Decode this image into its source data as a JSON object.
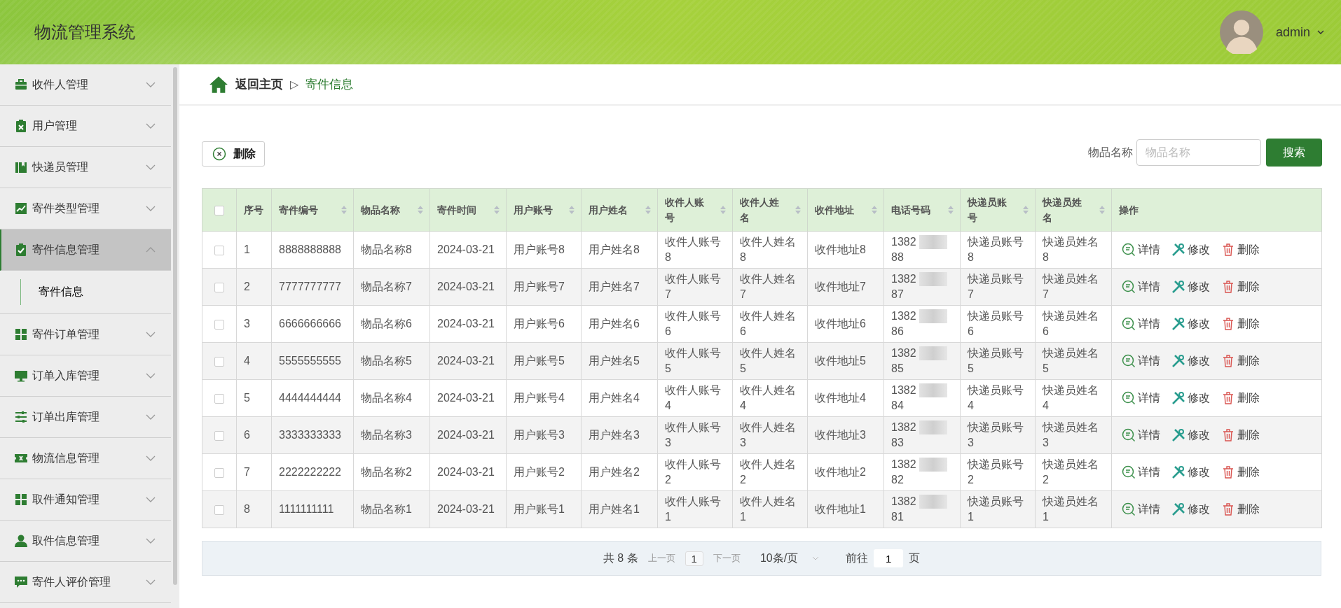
{
  "header": {
    "title": "物流管理系统",
    "user": "admin"
  },
  "sidebar": {
    "items": [
      {
        "label": "收件人管理",
        "expanded": false,
        "selected": false
      },
      {
        "label": "用户管理",
        "expanded": false,
        "selected": false
      },
      {
        "label": "快递员管理",
        "expanded": false,
        "selected": false
      },
      {
        "label": "寄件类型管理",
        "expanded": false,
        "selected": false
      },
      {
        "label": "寄件信息管理",
        "expanded": true,
        "selected": true,
        "children": [
          {
            "label": "寄件信息",
            "selected": false
          }
        ]
      },
      {
        "label": "寄件订单管理",
        "expanded": false,
        "selected": false
      },
      {
        "label": "订单入库管理",
        "expanded": false,
        "selected": false
      },
      {
        "label": "订单出库管理",
        "expanded": false,
        "selected": false
      },
      {
        "label": "物流信息管理",
        "expanded": false,
        "selected": false
      },
      {
        "label": "取件通知管理",
        "expanded": false,
        "selected": false
      },
      {
        "label": "取件信息管理",
        "expanded": false,
        "selected": false
      },
      {
        "label": "寄件人评价管理",
        "expanded": false,
        "selected": false
      }
    ]
  },
  "breadcrumb": {
    "home": "返回主页",
    "separator": "▷",
    "current": "寄件信息"
  },
  "toolbar": {
    "delete_button": "删除",
    "search_label": "物品名称",
    "search_placeholder": "物品名称",
    "search_button": "搜索"
  },
  "table": {
    "header_checked": false,
    "columns": [
      {
        "label": "序号",
        "sortable": false,
        "kind": "text"
      },
      {
        "label": "寄件编号",
        "sortable": true,
        "kind": "text"
      },
      {
        "label": "物品名称",
        "sortable": true,
        "kind": "text"
      },
      {
        "label": "寄件时间",
        "sortable": true,
        "kind": "text"
      },
      {
        "label": "用户账号",
        "sortable": true,
        "kind": "text"
      },
      {
        "label": "用户姓名",
        "sortable": true,
        "kind": "text"
      },
      {
        "label": "收件人账号",
        "sortable": true,
        "kind": "text"
      },
      {
        "label": "收件人姓名",
        "sortable": true,
        "kind": "text"
      },
      {
        "label": "收件地址",
        "sortable": true,
        "kind": "text"
      },
      {
        "label": "电话号码",
        "sortable": true,
        "kind": "masked"
      },
      {
        "label": "快递员账号",
        "sortable": true,
        "kind": "text"
      },
      {
        "label": "快递员姓名",
        "sortable": true,
        "kind": "text"
      },
      {
        "label": "操作",
        "sortable": false,
        "kind": "actions"
      }
    ],
    "rows": [
      {
        "checked": false,
        "cells": [
          "1",
          "8888888888",
          "物品名称8",
          "2024-03-21",
          "用户账号8",
          "用户姓名8",
          "收件人账号8",
          "收件人姓名8",
          "收件地址8",
          "1382",
          "快递员账号8",
          "快递员姓名8"
        ],
        "phone_tail": "88",
        "actions": [
          "详情",
          "修改",
          "删除"
        ]
      },
      {
        "checked": false,
        "cells": [
          "2",
          "7777777777",
          "物品名称7",
          "2024-03-21",
          "用户账号7",
          "用户姓名7",
          "收件人账号7",
          "收件人姓名7",
          "收件地址7",
          "1382",
          "快递员账号7",
          "快递员姓名7"
        ],
        "phone_tail": "87",
        "actions": [
          "详情",
          "修改",
          "删除"
        ]
      },
      {
        "checked": false,
        "cells": [
          "3",
          "6666666666",
          "物品名称6",
          "2024-03-21",
          "用户账号6",
          "用户姓名6",
          "收件人账号6",
          "收件人姓名6",
          "收件地址6",
          "1382",
          "快递员账号6",
          "快递员姓名6"
        ],
        "phone_tail": "86",
        "actions": [
          "详情",
          "修改",
          "删除"
        ]
      },
      {
        "checked": false,
        "cells": [
          "4",
          "5555555555",
          "物品名称5",
          "2024-03-21",
          "用户账号5",
          "用户姓名5",
          "收件人账号5",
          "收件人姓名5",
          "收件地址5",
          "1382",
          "快递员账号5",
          "快递员姓名5"
        ],
        "phone_tail": "85",
        "actions": [
          "详情",
          "修改",
          "删除"
        ]
      },
      {
        "checked": false,
        "cells": [
          "5",
          "4444444444",
          "物品名称4",
          "2024-03-21",
          "用户账号4",
          "用户姓名4",
          "收件人账号4",
          "收件人姓名4",
          "收件地址4",
          "1382",
          "快递员账号4",
          "快递员姓名4"
        ],
        "phone_tail": "84",
        "actions": [
          "详情",
          "修改",
          "删除"
        ]
      },
      {
        "checked": false,
        "cells": [
          "6",
          "3333333333",
          "物品名称3",
          "2024-03-21",
          "用户账号3",
          "用户姓名3",
          "收件人账号3",
          "收件人姓名3",
          "收件地址3",
          "1382",
          "快递员账号3",
          "快递员姓名3"
        ],
        "phone_tail": "83",
        "actions": [
          "详情",
          "修改",
          "删除"
        ]
      },
      {
        "checked": false,
        "cells": [
          "7",
          "2222222222",
          "物品名称2",
          "2024-03-21",
          "用户账号2",
          "用户姓名2",
          "收件人账号2",
          "收件人姓名2",
          "收件地址2",
          "1382",
          "快递员账号2",
          "快递员姓名2"
        ],
        "phone_tail": "82",
        "actions": [
          "详情",
          "修改",
          "删除"
        ]
      },
      {
        "checked": false,
        "cells": [
          "8",
          "1111111111",
          "物品名称1",
          "2024-03-21",
          "用户账号1",
          "用户姓名1",
          "收件人账号1",
          "收件人姓名1",
          "收件地址1",
          "1382",
          "快递员账号1",
          "快递员姓名1"
        ],
        "phone_tail": "81",
        "actions": [
          "详情",
          "修改",
          "删除"
        ]
      }
    ]
  },
  "pagination": {
    "total": "共 8 条",
    "prev": "上一页",
    "page": "1",
    "next": "下一页",
    "page_size": "10条/页",
    "goto_label": "前往",
    "goto_value": "1",
    "goto_suffix": "页"
  }
}
